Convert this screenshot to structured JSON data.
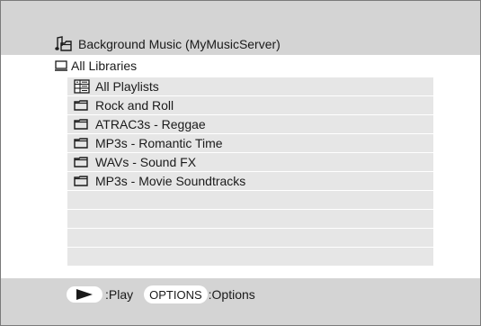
{
  "header": {
    "path_text": "Background Music  (MyMusicServer)",
    "path_icon": "music-note-folder-icon"
  },
  "libraries": {
    "label": "All Libraries",
    "icon": "monitor-icon"
  },
  "list": {
    "items": [
      {
        "label": "All Playlists",
        "icon": "playlist-grid-icon"
      },
      {
        "label": "Rock and Roll",
        "icon": "folder-icon"
      },
      {
        "label": "ATRAC3s - Reggae",
        "icon": "folder-icon"
      },
      {
        "label": "MP3s - Romantic Time",
        "icon": "folder-icon"
      },
      {
        "label": "WAVs - Sound FX",
        "icon": "folder-icon"
      },
      {
        "label": "MP3s - Movie Soundtracks",
        "icon": "folder-icon"
      }
    ],
    "empty_rows": 4
  },
  "footer": {
    "play_button_icon": "play-triangle-icon",
    "play_label": ":Play",
    "options_button_label": "OPTIONS",
    "options_label": ":Options"
  },
  "colors": {
    "band_gray": "#d4d4d4",
    "row_gray": "#e6e6e6",
    "text": "#1a1a1a"
  }
}
